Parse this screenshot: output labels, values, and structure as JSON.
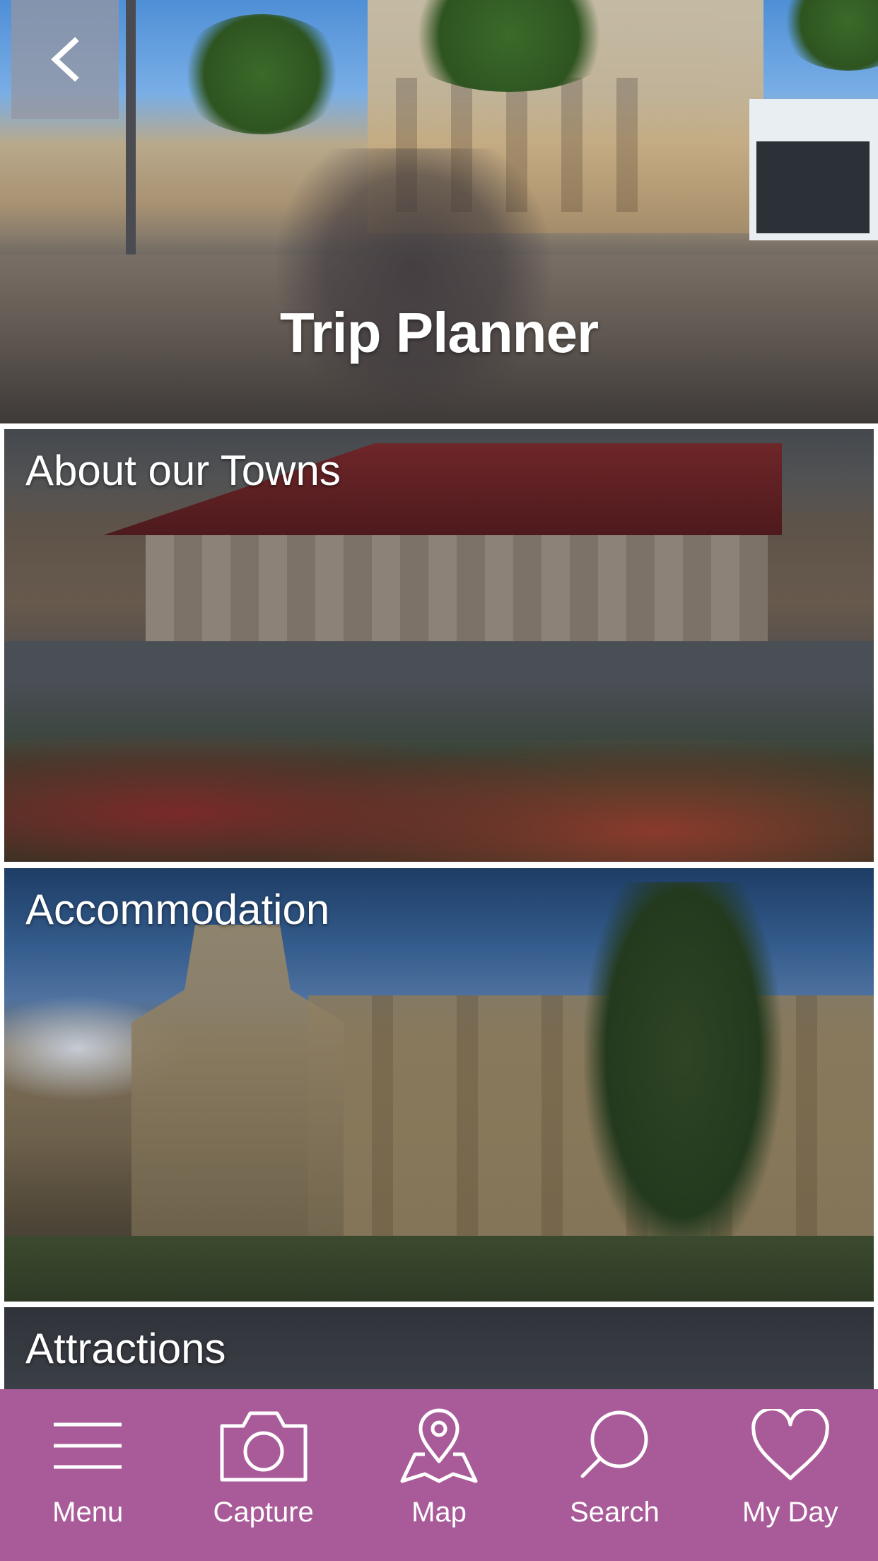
{
  "header": {
    "title": "Trip Planner",
    "back_icon": "chevron-left-icon"
  },
  "categories": [
    {
      "label": "About our Towns"
    },
    {
      "label": "Accommodation"
    },
    {
      "label": "Attractions"
    }
  ],
  "bottom_nav": {
    "background": "#a85b98",
    "items": [
      {
        "label": "Menu",
        "icon": "hamburger-menu-icon"
      },
      {
        "label": "Capture",
        "icon": "camera-icon"
      },
      {
        "label": "Map",
        "icon": "map-pin-icon"
      },
      {
        "label": "Search",
        "icon": "search-icon"
      },
      {
        "label": "My Day",
        "icon": "heart-icon"
      }
    ]
  }
}
